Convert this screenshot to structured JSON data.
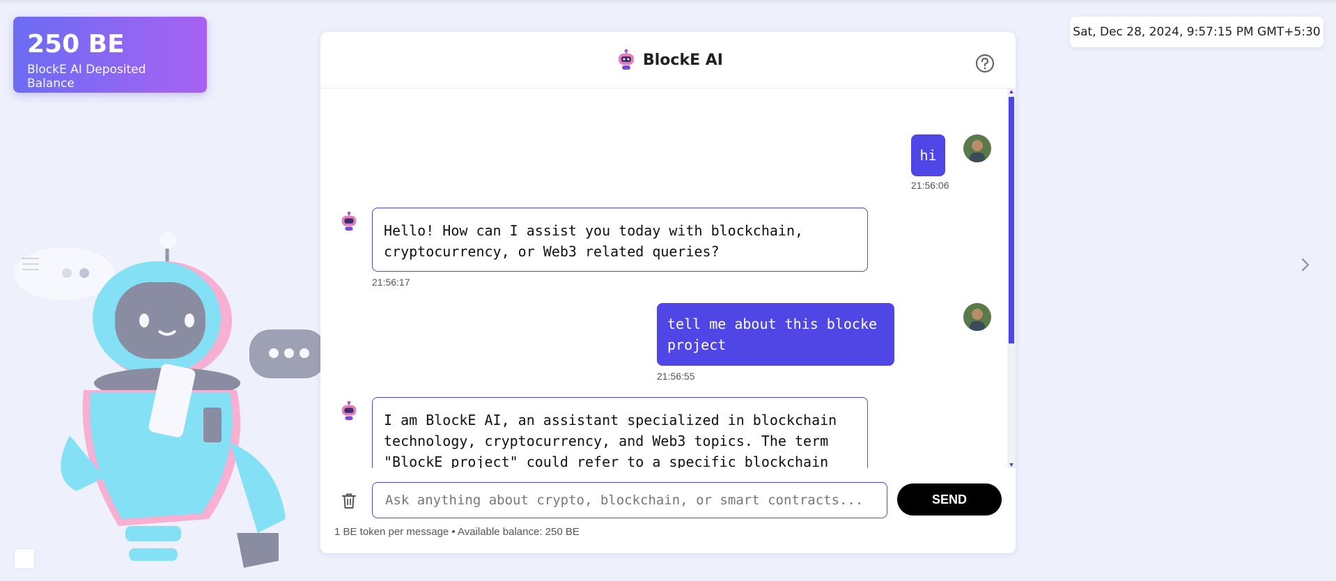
{
  "balance": {
    "amount": "250 BE",
    "label": "BlockE AI Deposited Balance"
  },
  "datetime": "Sat, Dec 28, 2024, 9:57:15 PM GMT+5:30",
  "chat": {
    "title": "BlockE AI",
    "messages": [
      {
        "role": "user",
        "text": "hi",
        "time": "21:56:06"
      },
      {
        "role": "assistant",
        "text": "Hello! How can I assist you today with blockchain, cryptocurrency, or Web3 related queries?",
        "time": "21:56:17"
      },
      {
        "role": "user",
        "text": "tell me about this blocke project",
        "time": "21:56:55"
      },
      {
        "role": "assistant",
        "text": "I am BlockE AI, an assistant specialized in blockchain technology, cryptocurrency, and Web3 topics. The term \"BlockE project\" could refer to a specific blockchain project, but without more context, I can't provide detailed information."
      }
    ],
    "input": {
      "placeholder": "Ask anything about crypto, blockchain, or smart contracts..."
    },
    "send_label": "SEND",
    "footer_note": "1 BE token per message • Available balance: 250 BE"
  },
  "colors": {
    "accent": "#5046e5",
    "gradient_start": "#6b6cf3",
    "gradient_end": "#a862f2",
    "send": "#000000"
  },
  "icons": [
    "menu-icon",
    "chevron-right-icon",
    "help-icon",
    "bot-logo-icon",
    "trash-icon",
    "user-avatar"
  ]
}
